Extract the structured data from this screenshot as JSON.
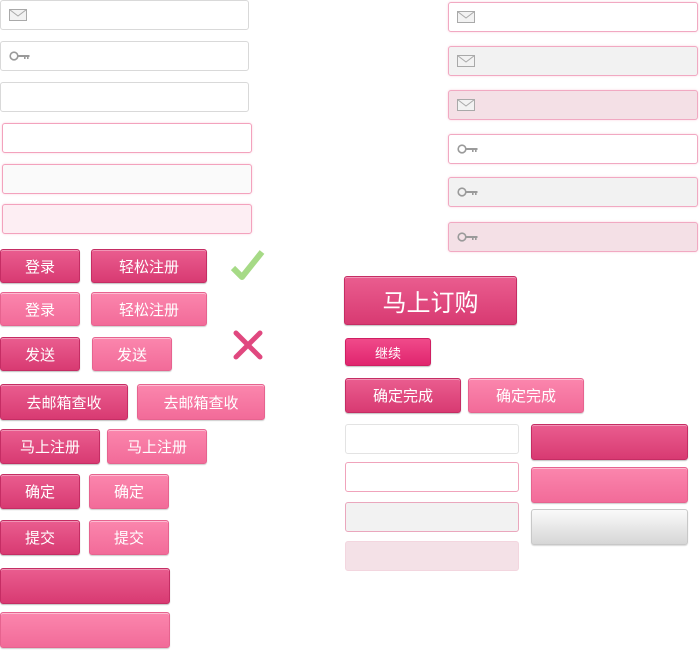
{
  "colors": {
    "accent_dark": "#d83a72",
    "accent_light": "#f26b99",
    "check_green": "#9fd77f",
    "cross_pink": "#e0487f"
  },
  "icons": {
    "mail": "mail-icon",
    "key": "key-icon",
    "check": "check-icon",
    "cross": "cross-icon"
  },
  "left_buttons": {
    "login_dark": "登录",
    "register_dark": "轻松注册",
    "login_light": "登录",
    "register_light": "轻松注册",
    "send_dark": "发送",
    "send_light": "发送",
    "check_mail_dark": "去邮箱查收",
    "check_mail_light": "去邮箱查收",
    "register_now_dark": "马上注册",
    "register_now_light": "马上注册",
    "confirm_dark": "确定",
    "confirm_light": "确定",
    "submit_dark": "提交",
    "submit_light": "提交"
  },
  "right_buttons": {
    "order_now": "马上订购",
    "continue": "继续",
    "done_dark": "确定完成",
    "done_light": "确定完成"
  }
}
